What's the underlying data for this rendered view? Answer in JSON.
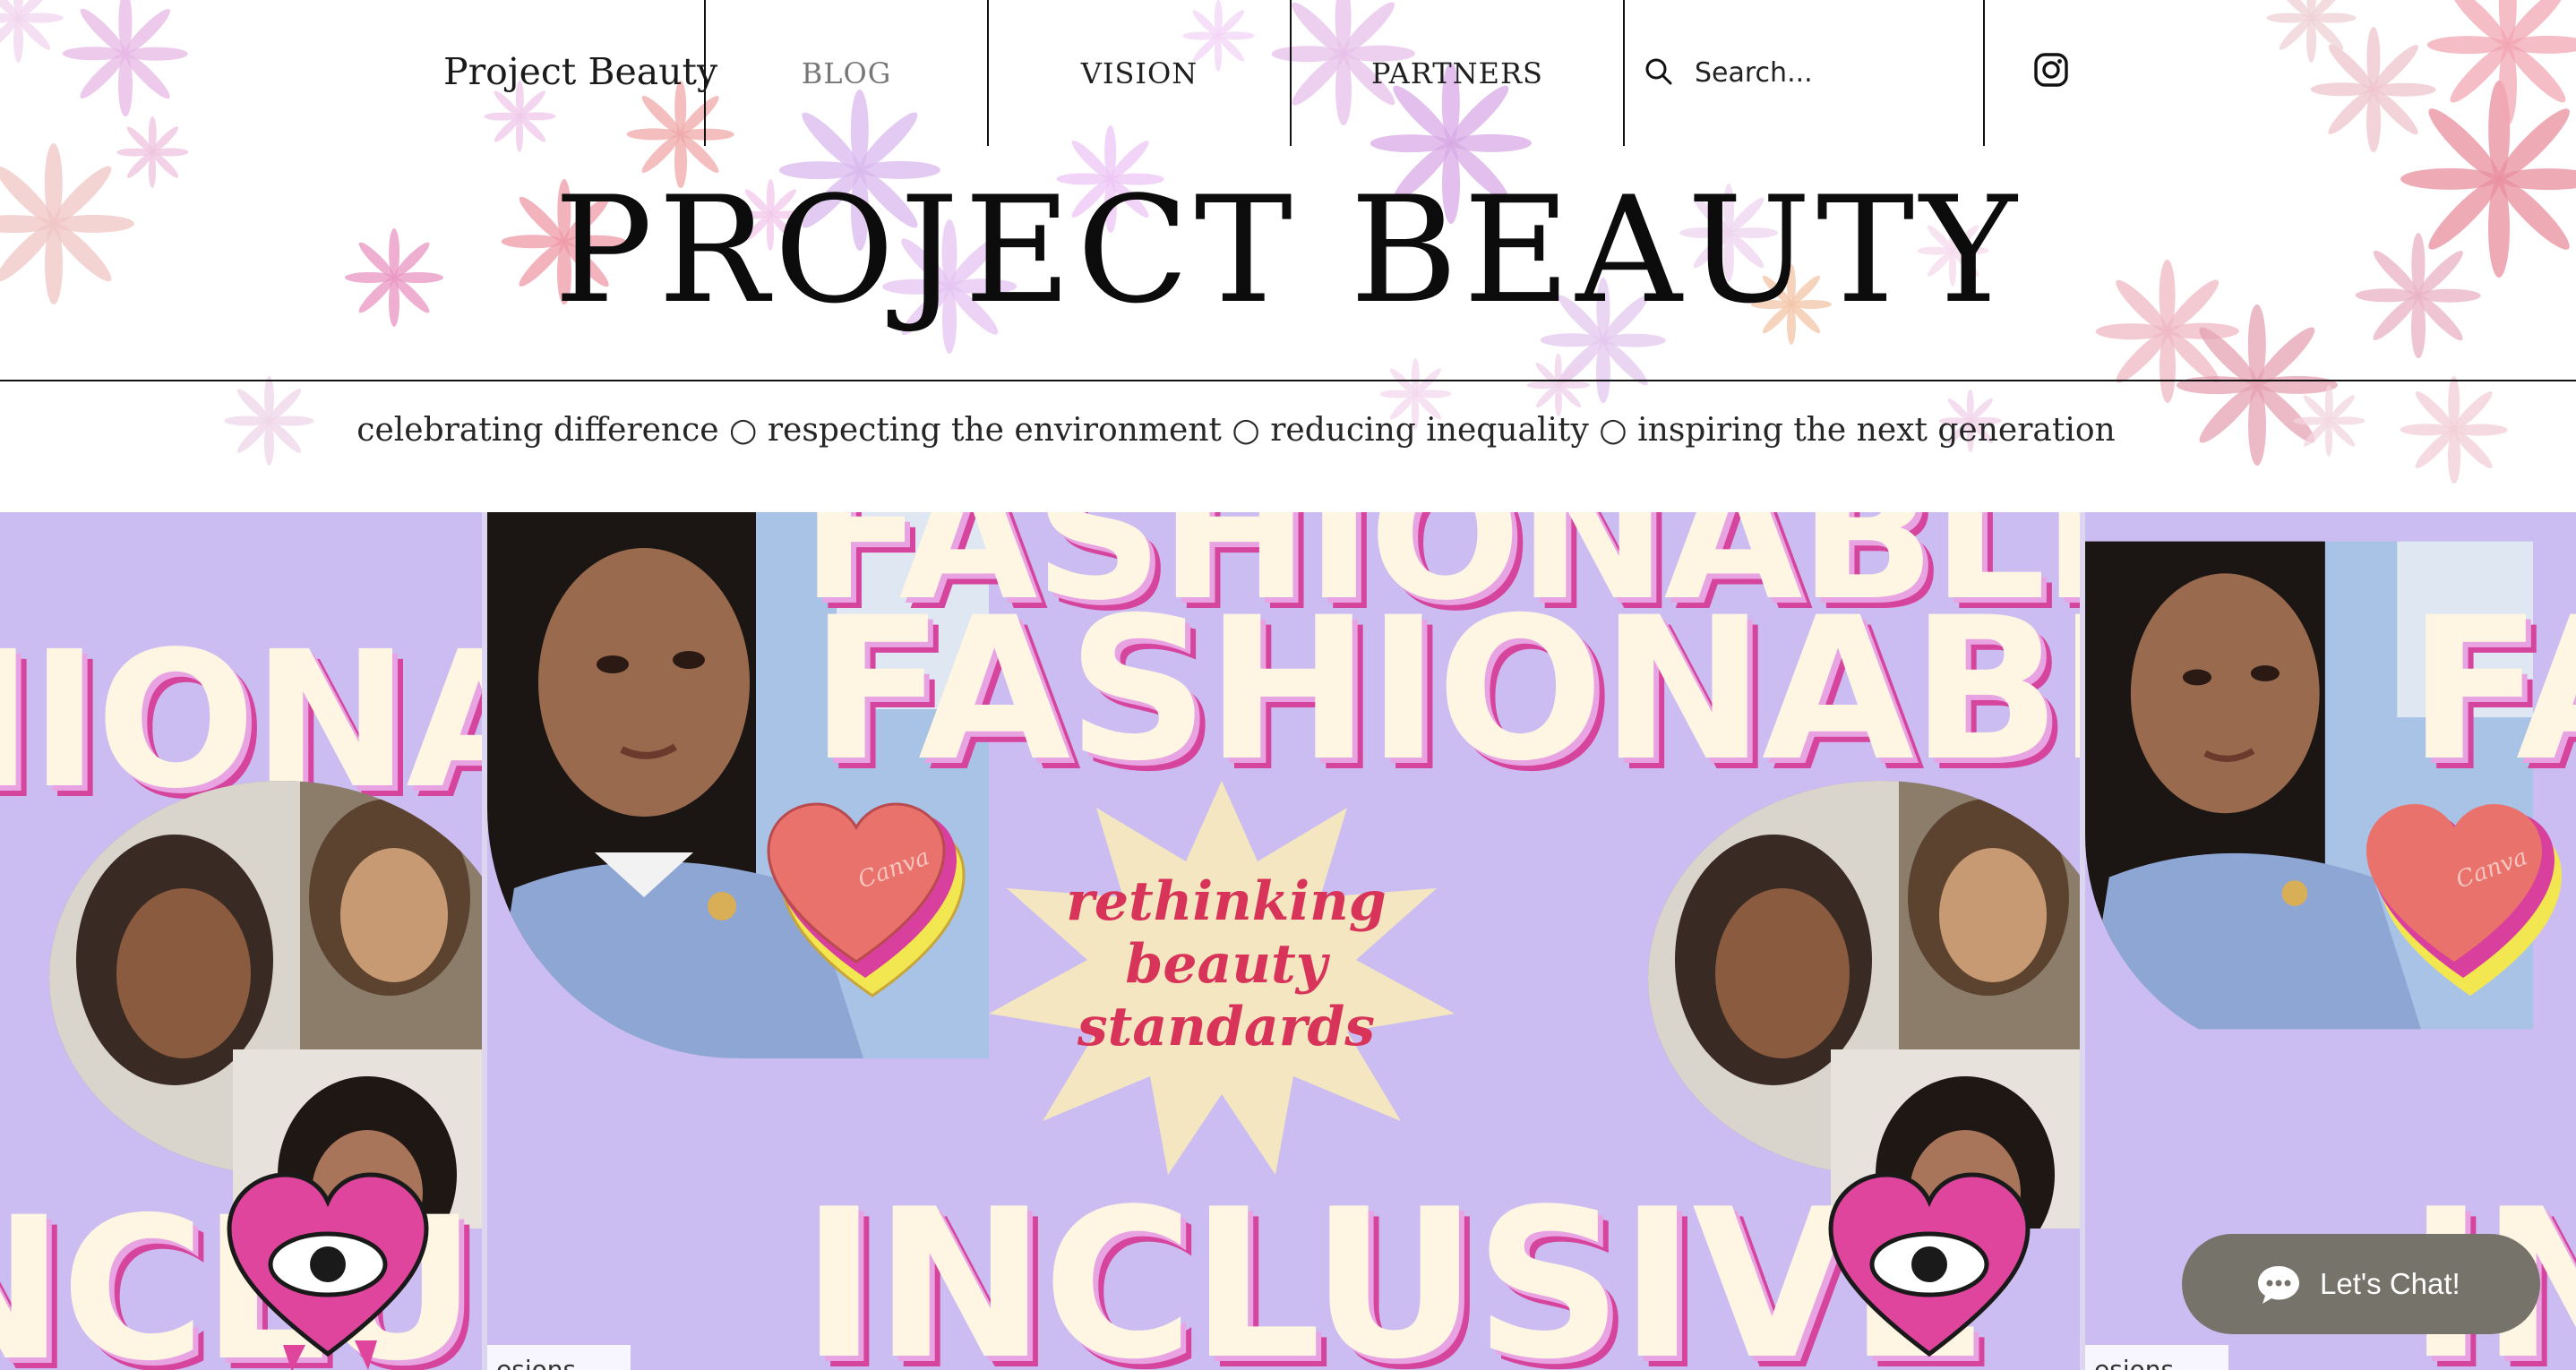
{
  "header": {
    "site_name": "Project Beauty",
    "nav": [
      {
        "label": "BLOG",
        "active": true
      },
      {
        "label": "VISION",
        "active": false
      },
      {
        "label": "PARTNERS",
        "active": false
      }
    ],
    "search": {
      "placeholder": "Search...",
      "value": "",
      "icon": "search-icon"
    },
    "social": {
      "icon": "instagram-icon"
    }
  },
  "hero": {
    "title": "PROJECT BEAUTY",
    "tagline": "celebrating difference ○ respecting the environment ○ reducing inequality ○ inspiring the next generation"
  },
  "gallery": {
    "slide_words": [
      "FASHIONABLE",
      "INCLUSIVE"
    ],
    "burst_text": [
      "rethinking",
      "beauty",
      "standards"
    ],
    "sticker_text": "Canva",
    "caption_partial": "esions"
  },
  "chat": {
    "label": "Let's Chat!",
    "icon": "chat-bubble-icon"
  },
  "colors": {
    "slide_bg": "#cbbdf2",
    "letter_cream": "#fff5e3",
    "letter_pink": "#d6459d",
    "burst_cream": "#f3e6c0",
    "burst_text": "#d8345a",
    "heart_coral": "#e9736c",
    "heart_magenta": "#d93f9c",
    "heart_yellow": "#f2e651",
    "chat_bg": "#75736a"
  }
}
